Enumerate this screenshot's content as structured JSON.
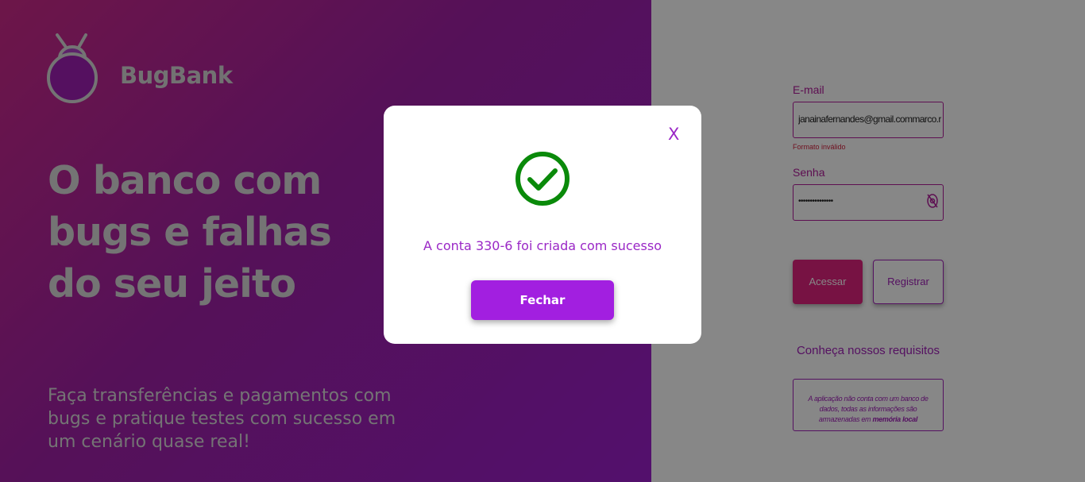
{
  "brand": {
    "name": "BugBank"
  },
  "hero": {
    "headline": "O banco com bugs e falhas do seu jeito",
    "subtext": "Faça transferências e pagamentos com bugs e pratique testes com sucesso em um cenário quase real!"
  },
  "login": {
    "email_label": "E-mail",
    "email_value": "janainafernandes@gmail.commarco.rodrigues",
    "email_error": "Formato inválido",
    "password_label": "Senha",
    "password_value": "•••••••••••••••",
    "acessar_label": "Acessar",
    "registrar_label": "Registrar"
  },
  "requirements": {
    "title": "Conheça nossos requisitos",
    "text_prefix": "A aplicação não conta com um banco de dados, todas as informações são armazenadas em ",
    "text_bold": "memória local"
  },
  "modal": {
    "close_label": "X",
    "message": "A conta 330-6 foi criada com sucesso",
    "button_label": "Fechar"
  },
  "colors": {
    "accent": "#a21fe0",
    "success": "#0a8a0a",
    "brand_pink": "#e0227f"
  },
  "icons": {
    "logo": "bug-logo-icon",
    "success": "check-circle-icon",
    "password_toggle": "eye-slash-icon"
  }
}
